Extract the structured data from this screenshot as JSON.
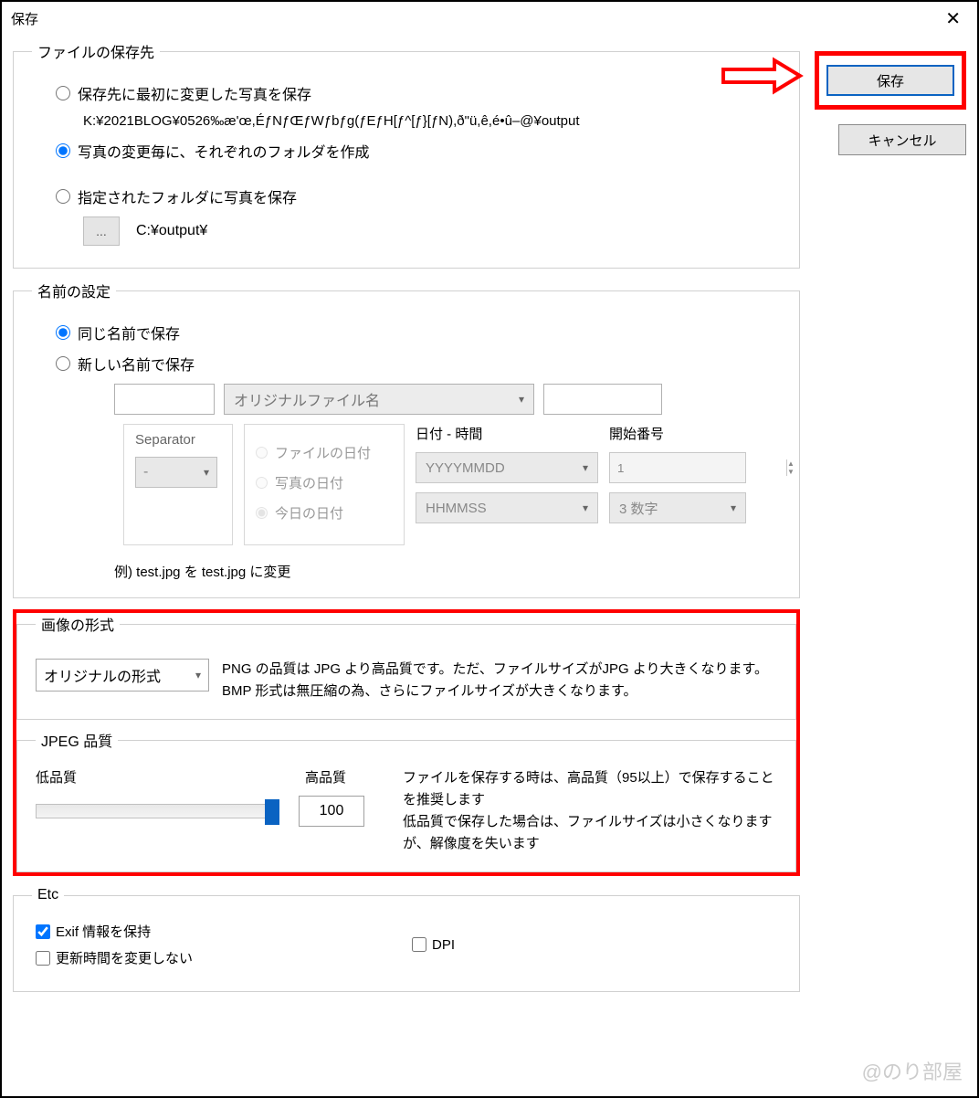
{
  "window": {
    "title": "保存"
  },
  "buttons": {
    "save": "保存",
    "cancel": "キャンセル"
  },
  "dest": {
    "legend": "ファイルの保存先",
    "opt1": "保存先に最初に変更した写真を保存",
    "opt1_path": "K:¥2021BLOG¥0526‰æ'œ,ÉƒNƒŒƒWƒbƒg(ƒEƒH[ƒ^[ƒ}[ƒN),ð\"ü,ê,é•û–@¥output",
    "opt2": "写真の変更毎に、それぞれのフォルダを作成",
    "opt3": "指定されたフォルダに写真を保存",
    "opt3_path": "C:¥output¥",
    "browse": "..."
  },
  "name": {
    "legend": "名前の設定",
    "opt1": "同じ名前で保存",
    "opt2": "新しい名前で保存",
    "combo_placeholder": "オリジナルファイル名",
    "sep_title": "Separator",
    "sep_value": "-",
    "date_opt1": "ファイルの日付",
    "date_opt2": "写真の日付",
    "date_opt3": "今日の日付",
    "dt_title": "日付 - 時間",
    "dt_fmt1": "YYYYMMDD",
    "dt_fmt2": "HHMMSS",
    "start_title": "開始番号",
    "start_val": "1",
    "start_digits": "3 数字",
    "example": "例) test.jpg を test.jpg に変更"
  },
  "format": {
    "legend": "画像の形式",
    "combo": "オリジナルの形式",
    "desc": "PNG の品質は JPG より高品質です。ただ、ファイルサイズがJPG より大きくなります。BMP 形式は無圧縮の為、さらにファイルサイズが大きくなります。"
  },
  "jpeg": {
    "legend": "JPEG 品質",
    "low": "低品質",
    "high": "高品質",
    "value": "100",
    "desc": "ファイルを保存する時は、高品質（95以上）で保存することを推奨します\n低品質で保存した場合は、ファイルサイズは小さくなりますが、解像度を失います"
  },
  "etc": {
    "legend": "Etc",
    "exif": "Exif 情報を保持",
    "dpi": "DPI",
    "mtime": "更新時間を変更しない"
  },
  "watermark": "@のり部屋"
}
